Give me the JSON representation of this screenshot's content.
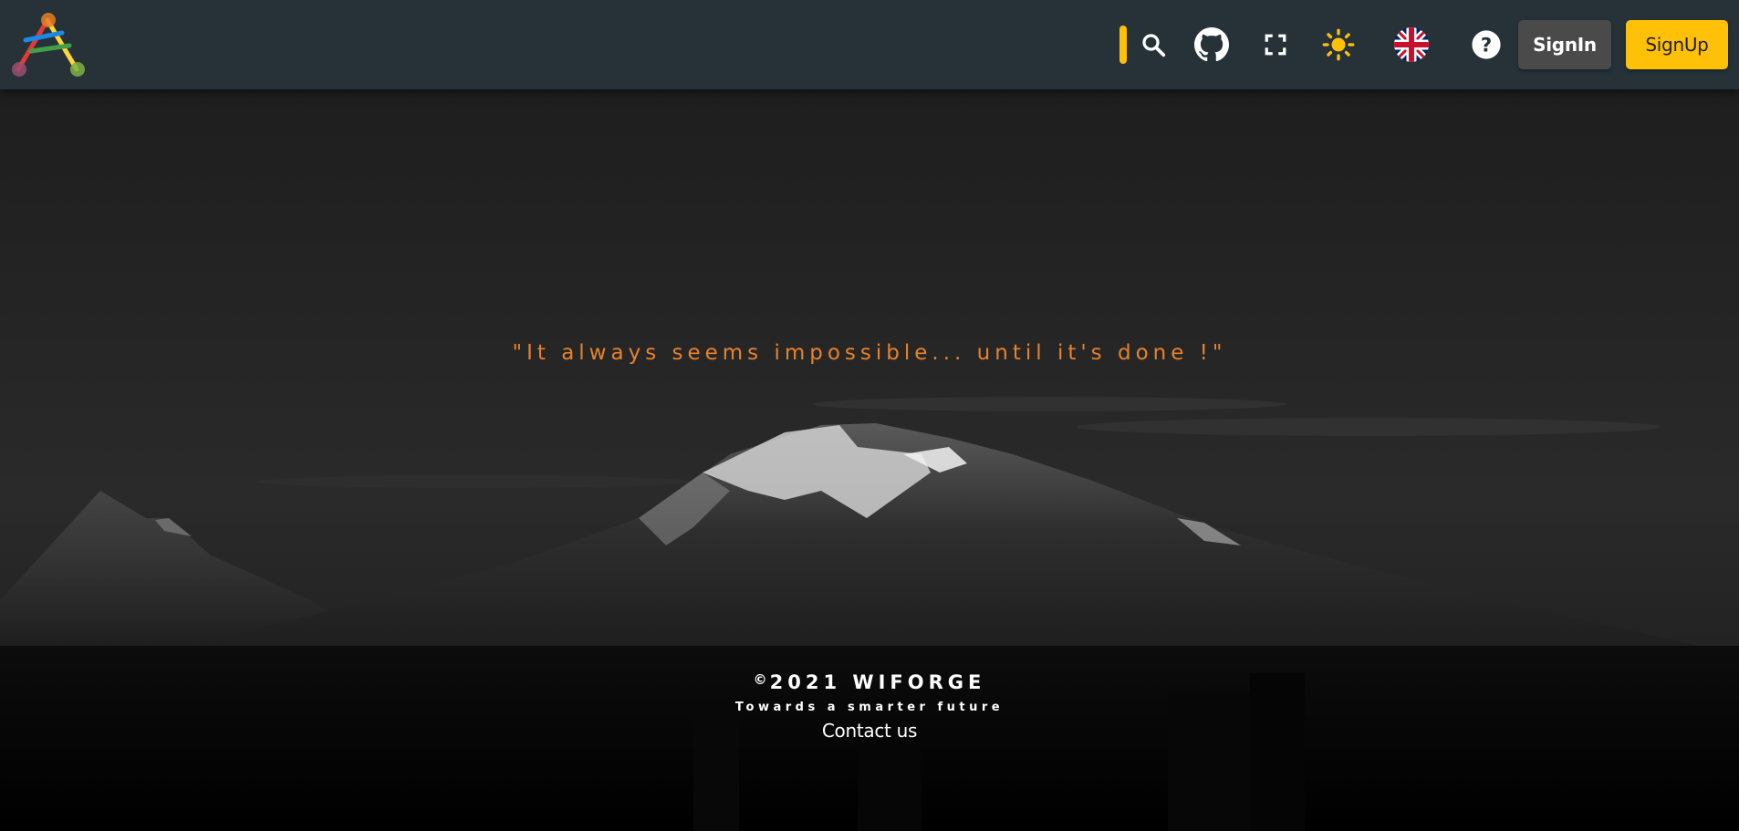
{
  "header": {
    "logo_alt": "A",
    "icons": [
      "search-icon",
      "github-icon",
      "fullscreen-icon",
      "sun-icon",
      "uk-flag-icon",
      "help-icon"
    ],
    "signin_label": "SignIn",
    "signup_label": "SignUp",
    "accent_color": "#ffc107",
    "bar_color": "#263238"
  },
  "hero": {
    "quote": "\"It always seems impossible... until it's done !\"",
    "quote_color": "#e8822a"
  },
  "footer": {
    "copyright_symbol": "©",
    "copyright_text": "2021 WIFORGE",
    "tagline": "Towards a smarter future",
    "contact_label": "Contact us"
  }
}
